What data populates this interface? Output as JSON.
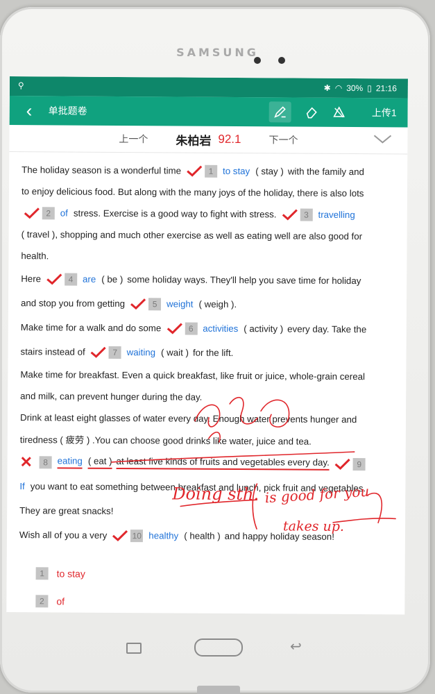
{
  "device": {
    "brand": "SAMSUNG"
  },
  "status_bar": {
    "battery": "30%",
    "time": "21:16"
  },
  "app_bar": {
    "title": "单批题卷",
    "upload_label": "上传1"
  },
  "student_bar": {
    "prev": "上一个",
    "name": "朱柏岩",
    "score": "92.1",
    "next": "下一个"
  },
  "text": {
    "l1a": "The holiday season is a wonderful time",
    "n1": "1",
    "a1": "to stay",
    "h1": "( stay )",
    "l1b": "with the family and",
    "l2": "to enjoy delicious food. But along with the many joys of the holiday, there is also lots",
    "n2": "2",
    "a2": "of",
    "l3b": "stress. Exercise is a good way to fight with stress.",
    "n3": "3",
    "a3": "travelling",
    "l4": "( travel ), shopping and much other exercise as well as eating well are also good for",
    "l5": "health.",
    "l6a": "Here",
    "n4": "4",
    "a4": "are",
    "h4": "( be )",
    "l6b": "some holiday ways. They'll help you save time for holiday",
    "l7a": "and stop you from getting",
    "n5": "5",
    "a5": "weight",
    "h5": "( weigh ).",
    "l8a": "Make time for a walk and do some",
    "n6": "6",
    "a6": "activities",
    "h6": "( activity )",
    "l8b": "every day. Take the",
    "l9a": "stairs instead of",
    "n7": "7",
    "a7": "waiting",
    "h7": "( wait )",
    "l9b": "for the lift.",
    "l10": "Make time for breakfast. Even a quick breakfast, like fruit or juice, whole-grain cereal",
    "l11": "and milk, can prevent hunger during the day.",
    "l12": "Drink at least eight glasses of water every day. Enough water prevents hunger and",
    "l13": "tiredness ( 疲劳 ) .You can choose good drinks like water, juice and tea.",
    "n8": "8",
    "a8": "eating",
    "h8": "( eat )",
    "l14b": "at least five kinds of fruits and vegetables every day.",
    "n9": "9",
    "a9": "If",
    "l15b": "you want to eat something between breakfast and lunch, pick fruit and vegetables.",
    "l16": "They are great snacks!",
    "l17a": "Wish all of you a very",
    "n10": "10",
    "a10": "healthy",
    "h10": "( health )",
    "l17b": "and happy holiday season!"
  },
  "answers": [
    {
      "num": "1",
      "value": "to stay"
    },
    {
      "num": "2",
      "value": "of"
    }
  ],
  "handwriting": {
    "h1": "Doing sth.",
    "h2": "is good for you",
    "h3": "takes up."
  },
  "colors": {
    "appbar": "#10a27f",
    "statusbar": "#0e876a",
    "answer_blue": "#1f72d8",
    "mark_red": "#e0262b"
  }
}
